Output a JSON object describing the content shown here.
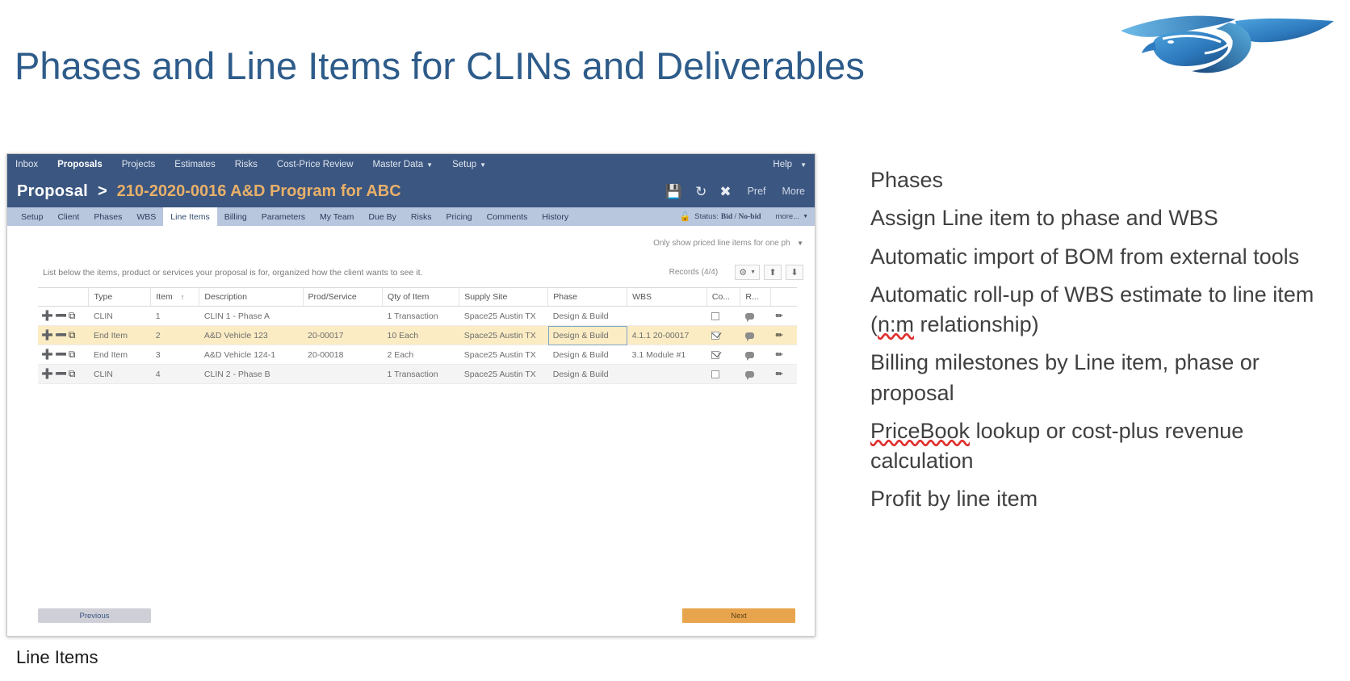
{
  "slide": {
    "title": "Phases and Line Items for CLINs and Deliverables",
    "caption": "Line Items",
    "logo_name": "bird-logo",
    "accent_blue": "#2E5C8A",
    "header_blue": "#3B5680",
    "tab_blue": "#B8C6DE",
    "gold": "#E8B06A",
    "row_highlight": "#FBECC4",
    "next_button_color": "#E8A54E"
  },
  "app": {
    "topnav": [
      {
        "label": "Inbox",
        "active": false,
        "caret": false
      },
      {
        "label": "Proposals",
        "active": true,
        "caret": false
      },
      {
        "label": "Projects",
        "active": false,
        "caret": false
      },
      {
        "label": "Estimates",
        "active": false,
        "caret": false
      },
      {
        "label": "Risks",
        "active": false,
        "caret": false
      },
      {
        "label": "Cost-Price Review",
        "active": false,
        "caret": false
      },
      {
        "label": "Master Data",
        "active": false,
        "caret": true
      },
      {
        "label": "Setup",
        "active": false,
        "caret": true
      }
    ],
    "help_label": "Help",
    "titlebar": {
      "crumb_main": "Proposal",
      "crumb_sep": ">",
      "crumb_sub": "210-2020-0016 A&D Program for ABC",
      "icons": [
        "save-icon",
        "refresh-icon",
        "close-icon"
      ],
      "pref_label": "Pref",
      "more_label": "More"
    },
    "tabs": [
      {
        "label": "Setup",
        "active": false
      },
      {
        "label": "Client",
        "active": false
      },
      {
        "label": "Phases",
        "active": false
      },
      {
        "label": "WBS",
        "active": false
      },
      {
        "label": "Line Items",
        "active": true
      },
      {
        "label": "Billing",
        "active": false
      },
      {
        "label": "Parameters",
        "active": false
      },
      {
        "label": "My Team",
        "active": false
      },
      {
        "label": "Due By",
        "active": false
      },
      {
        "label": "Risks",
        "active": false
      },
      {
        "label": "Pricing",
        "active": false
      },
      {
        "label": "Comments",
        "active": false
      },
      {
        "label": "History",
        "active": false
      }
    ],
    "status": {
      "lock_icon": "unlock-icon",
      "label": "Status:",
      "value": "Bid / No-bid",
      "more_label": "more..."
    },
    "filter_label": "Only show priced line items for one pha",
    "intro_text": "List below the items, product or services your proposal is for, organized how the client wants to see it.",
    "records_label": "Records (4/4)",
    "toolbar": {
      "settings_icon": "gear-icon",
      "settings_caret": "▾",
      "upload_icon": "upload-icon",
      "download_icon": "download-icon"
    },
    "grid": {
      "columns": [
        "",
        "Type",
        "Item",
        "Description",
        "Prod/Service",
        "Qty of Item",
        "Supply Site",
        "Phase",
        "WBS",
        "Co...",
        "R...",
        ""
      ],
      "sort_column": "Item",
      "sort_arrow": "↑",
      "rows": [
        {
          "type": "CLIN",
          "item": "1",
          "description": "CLIN 1 - Phase A",
          "prod_service": "",
          "qty": "1 Transaction",
          "supply_site": "Space25 Austin TX",
          "phase": "Design & Build",
          "wbs": "",
          "checked": false,
          "selected": false,
          "alt": false,
          "focus": false
        },
        {
          "type": "End Item",
          "item": "2",
          "description": "A&D Vehicle 123",
          "prod_service": "20-00017",
          "qty": "10 Each",
          "supply_site": "Space25 Austin TX",
          "phase": "Design & Build",
          "wbs": "4.1.1 20-00017",
          "checked": true,
          "selected": true,
          "alt": false,
          "focus": true
        },
        {
          "type": "End Item",
          "item": "3",
          "description": "A&D Vehicle 124-1",
          "prod_service": "20-00018",
          "qty": "2 Each",
          "supply_site": "Space25 Austin TX",
          "phase": "Design & Build",
          "wbs": "3.1 Module #1",
          "checked": true,
          "selected": false,
          "alt": false,
          "focus": false
        },
        {
          "type": "CLIN",
          "item": "4",
          "description": "CLIN 2 - Phase B",
          "prod_service": "",
          "qty": "1 Transaction",
          "supply_site": "Space25 Austin TX",
          "phase": "Design & Build",
          "wbs": "",
          "checked": false,
          "selected": false,
          "alt": true,
          "focus": false
        }
      ],
      "row_action_icons": [
        "add-icon",
        "remove-icon",
        "copy-icon"
      ],
      "edit_icon": "pencil-icon",
      "comment_icon": "comment-bubble-icon"
    },
    "footer": {
      "previous_label": "Previous",
      "next_label": "Next"
    }
  },
  "bullets": [
    {
      "text": "Phases",
      "wavy": []
    },
    {
      "text": "Assign Line item to phase and WBS",
      "wavy": []
    },
    {
      "text": "Automatic import of BOM from external tools",
      "wavy": []
    },
    {
      "text": "Automatic roll-up of WBS estimate to line item (n:m relationship)",
      "wavy": [
        "n:m"
      ]
    },
    {
      "text": "Billing milestones by Line item, phase or proposal",
      "wavy": []
    },
    {
      "text": "PriceBook lookup or cost-plus revenue calculation",
      "wavy": [
        "PriceBook"
      ]
    },
    {
      "text": "Profit by line item",
      "wavy": []
    }
  ]
}
